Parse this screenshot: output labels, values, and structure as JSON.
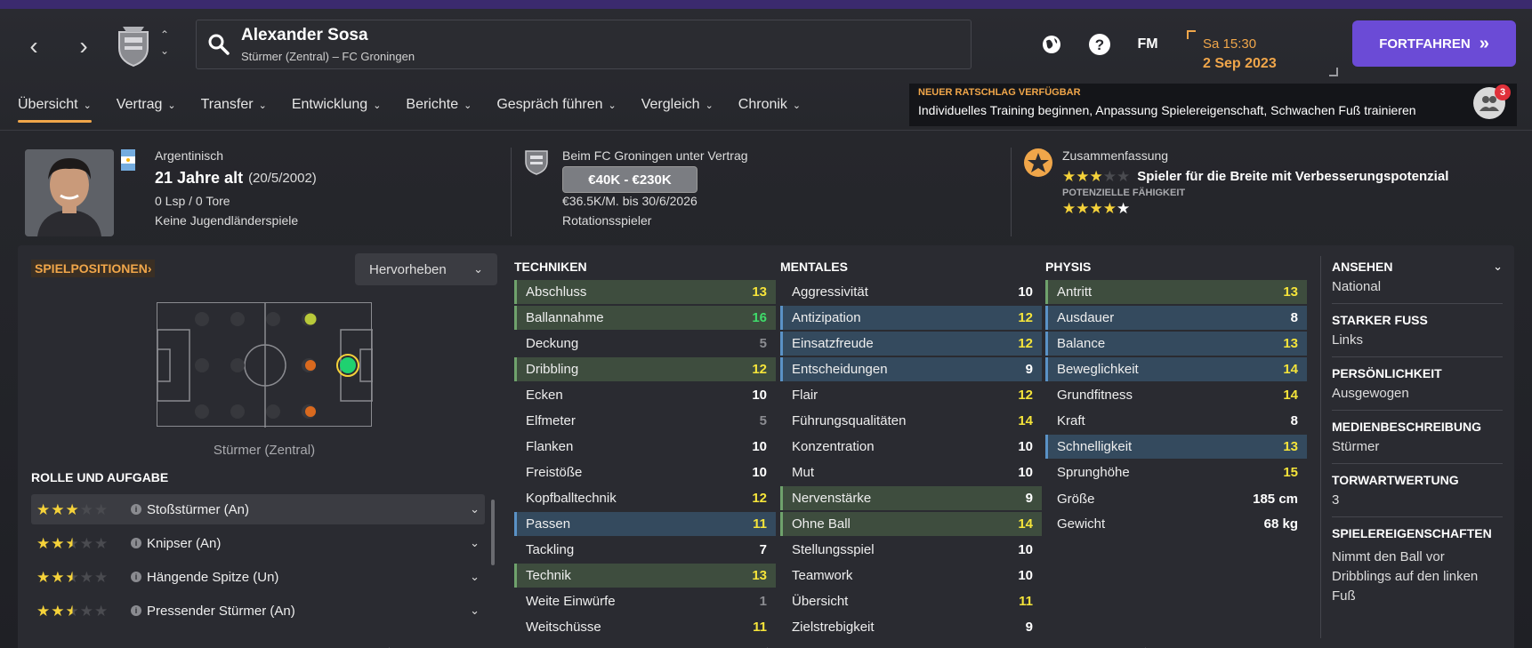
{
  "header": {
    "player_name": "Alexander Sosa",
    "player_subtitle": "Stürmer (Zentral) – FC Groningen",
    "fm_label": "FM",
    "day_time": "Sa 15:30",
    "date": "2 Sep 2023",
    "continue_label": "FORTFAHREN",
    "continue_icon": "»"
  },
  "tabs": [
    {
      "label": "Übersicht"
    },
    {
      "label": "Vertrag"
    },
    {
      "label": "Transfer"
    },
    {
      "label": "Entwicklung"
    },
    {
      "label": "Berichte"
    },
    {
      "label": "Gespräch führen"
    },
    {
      "label": "Vergleich"
    },
    {
      "label": "Chronik"
    }
  ],
  "advice": {
    "title": "NEUER RATSCHLAG VERFÜGBAR",
    "text": "Individuelles Training beginnen, Anpassung Spielereigenschaft, Schwachen Fuß trainieren",
    "count": "3"
  },
  "info": {
    "nationality": "Argentinisch",
    "age": "21 Jahre alt",
    "birthdate": "(20/5/2002)",
    "caps": "0 Lsp / 0 Tore",
    "youth_caps": "Keine Jugendländerspiele",
    "contract_club": "Beim FC Groningen unter Vertrag",
    "value": "€40K - €230K",
    "wage": "€36.5K/M. bis 30/6/2026",
    "squad_status": "Rotationsspieler",
    "summary_label": "Zusammenfassung",
    "summary_text": "Spieler für die Breite mit Verbesserungspotenzial",
    "potential_label": "POTENZIELLE FÄHIGKEIT",
    "current_stars": 3,
    "potential_stars": 4.5
  },
  "positions": {
    "title": "SPIELPOSITIONEN",
    "highlight_label": "Hervorheben",
    "position_label": "Stürmer (Zentral)"
  },
  "roles": {
    "title": "ROLLE UND AUFGABE",
    "items": [
      {
        "name": "Stoßstürmer (An)",
        "stars": 3
      },
      {
        "name": "Knipser (An)",
        "stars": 2.5
      },
      {
        "name": "Hängende Spitze (Un)",
        "stars": 2.5
      },
      {
        "name": "Pressender Stürmer (An)",
        "stars": 2.5
      }
    ]
  },
  "technical": {
    "title": "TECHNIKEN",
    "items": [
      {
        "name": "Abschluss",
        "value": "13",
        "hl": "g"
      },
      {
        "name": "Ballannahme",
        "value": "16",
        "hl": "g"
      },
      {
        "name": "Deckung",
        "value": "5",
        "hl": ""
      },
      {
        "name": "Dribbling",
        "value": "12",
        "hl": "g"
      },
      {
        "name": "Ecken",
        "value": "10",
        "hl": ""
      },
      {
        "name": "Elfmeter",
        "value": "5",
        "hl": ""
      },
      {
        "name": "Flanken",
        "value": "10",
        "hl": ""
      },
      {
        "name": "Freistöße",
        "value": "10",
        "hl": ""
      },
      {
        "name": "Kopfballtechnik",
        "value": "12",
        "hl": ""
      },
      {
        "name": "Passen",
        "value": "11",
        "hl": "b"
      },
      {
        "name": "Tackling",
        "value": "7",
        "hl": ""
      },
      {
        "name": "Technik",
        "value": "13",
        "hl": "g"
      },
      {
        "name": "Weite Einwürfe",
        "value": "1",
        "hl": ""
      },
      {
        "name": "Weitschüsse",
        "value": "11",
        "hl": ""
      }
    ]
  },
  "mental": {
    "title": "MENTALES",
    "items": [
      {
        "name": "Aggressivität",
        "value": "10",
        "hl": ""
      },
      {
        "name": "Antizipation",
        "value": "12",
        "hl": "b"
      },
      {
        "name": "Einsatzfreude",
        "value": "12",
        "hl": "b"
      },
      {
        "name": "Entscheidungen",
        "value": "9",
        "hl": "b"
      },
      {
        "name": "Flair",
        "value": "12",
        "hl": ""
      },
      {
        "name": "Führungsqualitäten",
        "value": "14",
        "hl": ""
      },
      {
        "name": "Konzentration",
        "value": "10",
        "hl": ""
      },
      {
        "name": "Mut",
        "value": "10",
        "hl": ""
      },
      {
        "name": "Nervenstärke",
        "value": "9",
        "hl": "g"
      },
      {
        "name": "Ohne Ball",
        "value": "14",
        "hl": "g"
      },
      {
        "name": "Stellungsspiel",
        "value": "10",
        "hl": ""
      },
      {
        "name": "Teamwork",
        "value": "10",
        "hl": ""
      },
      {
        "name": "Übersicht",
        "value": "11",
        "hl": ""
      },
      {
        "name": "Zielstrebigkeit",
        "value": "9",
        "hl": ""
      }
    ]
  },
  "physical": {
    "title": "PHYSIS",
    "items": [
      {
        "name": "Antritt",
        "value": "13",
        "hl": "g"
      },
      {
        "name": "Ausdauer",
        "value": "8",
        "hl": "b"
      },
      {
        "name": "Balance",
        "value": "13",
        "hl": "b"
      },
      {
        "name": "Beweglichkeit",
        "value": "14",
        "hl": "b"
      },
      {
        "name": "Grundfitness",
        "value": "14",
        "hl": ""
      },
      {
        "name": "Kraft",
        "value": "8",
        "hl": ""
      },
      {
        "name": "Schnelligkeit",
        "value": "13",
        "hl": "b"
      },
      {
        "name": "Sprunghöhe",
        "value": "15",
        "hl": ""
      }
    ],
    "height_label": "Größe",
    "height_value": "185 cm",
    "weight_label": "Gewicht",
    "weight_value": "68 kg"
  },
  "side": {
    "reputation_label": "ANSEHEN",
    "reputation_value": "National",
    "foot_label": "STARKER FUSS",
    "foot_value": "Links",
    "personality_label": "PERSÖNLICHKEIT",
    "personality_value": "Ausgewogen",
    "media_label": "MEDIENBESCHREIBUNG",
    "media_value": "Stürmer",
    "gk_label": "TORWARTWERTUNG",
    "gk_value": "3",
    "traits_label": "SPIELEREIGENSCHAFTEN",
    "traits_value": "Nimmt den Ball vor Dribblings auf den linken Fuß"
  }
}
